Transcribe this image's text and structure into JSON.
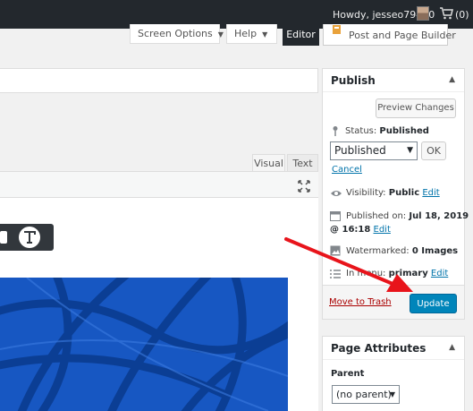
{
  "admin_bar": {
    "greeting": "Howdy, jesseo79440",
    "cart_count": "(0)",
    "icons": [
      "avatar",
      "cart-icon"
    ]
  },
  "top_buttons": {
    "screen_options": "Screen Options",
    "help": "Help",
    "editor": "Editor",
    "post_and_page_builder": "Post and Page Builder"
  },
  "editor": {
    "tabs": [
      {
        "label": "Visual"
      },
      {
        "label": "Text"
      }
    ],
    "image_color": "#1757c2"
  },
  "publish": {
    "title": "Publish",
    "preview_label": "Preview Changes",
    "status_label": "Status:",
    "status_value": "Published",
    "status_select": "Published",
    "ok_label": "OK",
    "cancel_label": "Cancel",
    "visibility_label": "Visibility:",
    "visibility_value": "Public",
    "visibility_edit": "Edit",
    "published_on_label": "Published on:",
    "published_on_date": "Jul 18, 2019",
    "published_on_time": "@ 16:18",
    "published_edit": "Edit",
    "watermarked_label": "Watermarked:",
    "watermarked_value": "0 Images",
    "menu_label": "In menu:",
    "menu_value": "primary",
    "menu_edit": "Edit",
    "trash_label": "Move to Trash",
    "update_label": "Update"
  },
  "page_attributes": {
    "title": "Page Attributes",
    "parent_label": "Parent",
    "parent_select": "(no parent)"
  },
  "colors": {
    "admin_bar": "#23282d",
    "primary_button": "#0085ba",
    "link": "#0073aa",
    "trash": "#a00",
    "annotation_arrow": "#e8141b"
  }
}
